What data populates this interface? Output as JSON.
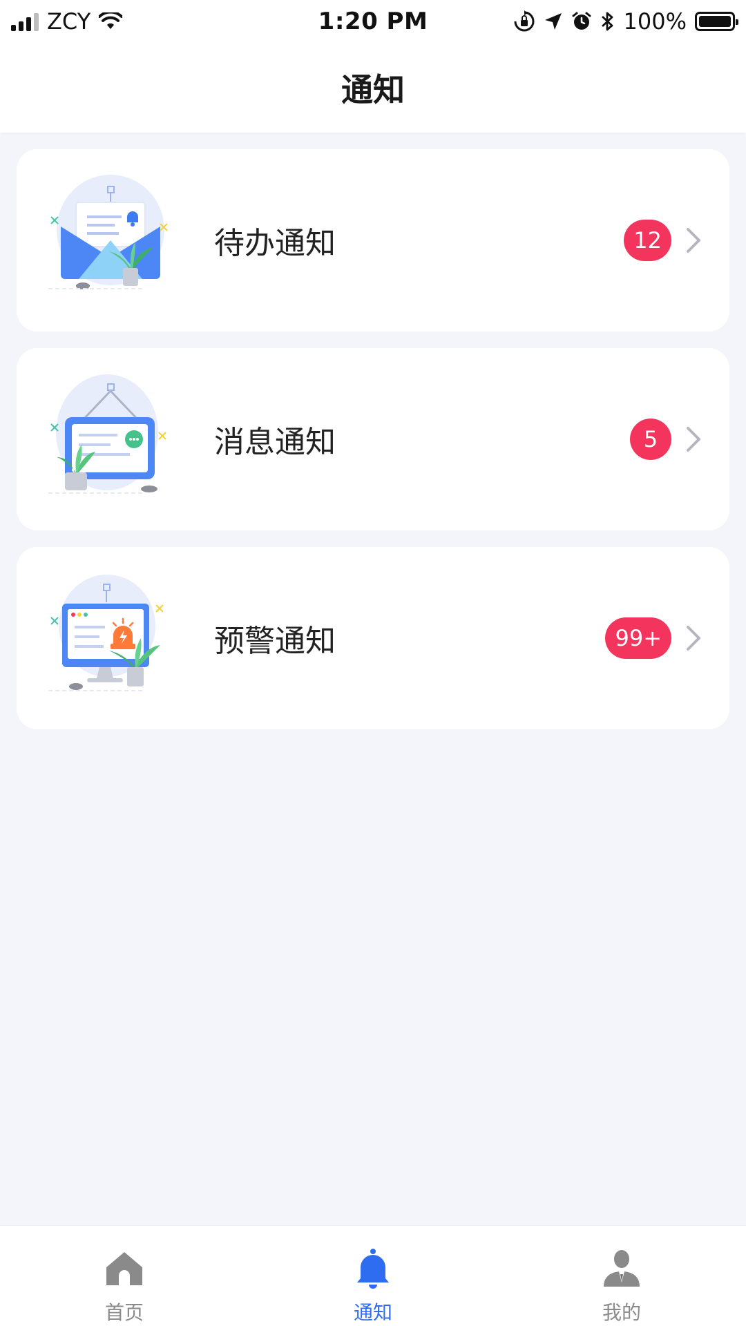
{
  "status_bar": {
    "carrier": "ZCY",
    "time": "1:20 PM",
    "battery": "100%"
  },
  "header": {
    "title": "通知"
  },
  "notifications": [
    {
      "label": "待办通知",
      "badge": "12",
      "icon": "mail-envelope-illustration"
    },
    {
      "label": "消息通知",
      "badge": "5",
      "icon": "message-board-illustration"
    },
    {
      "label": "预警通知",
      "badge": "99+",
      "icon": "alarm-monitor-illustration"
    }
  ],
  "tab_bar": {
    "items": [
      {
        "label": "首页",
        "icon": "home-icon",
        "active": false
      },
      {
        "label": "通知",
        "icon": "bell-icon",
        "active": true
      },
      {
        "label": "我的",
        "icon": "user-icon",
        "active": false
      }
    ],
    "active_color": "#2f6df0",
    "inactive_color": "#8a8a8a"
  },
  "colors": {
    "badge": "#f3355d",
    "background": "#f3f5fa"
  }
}
